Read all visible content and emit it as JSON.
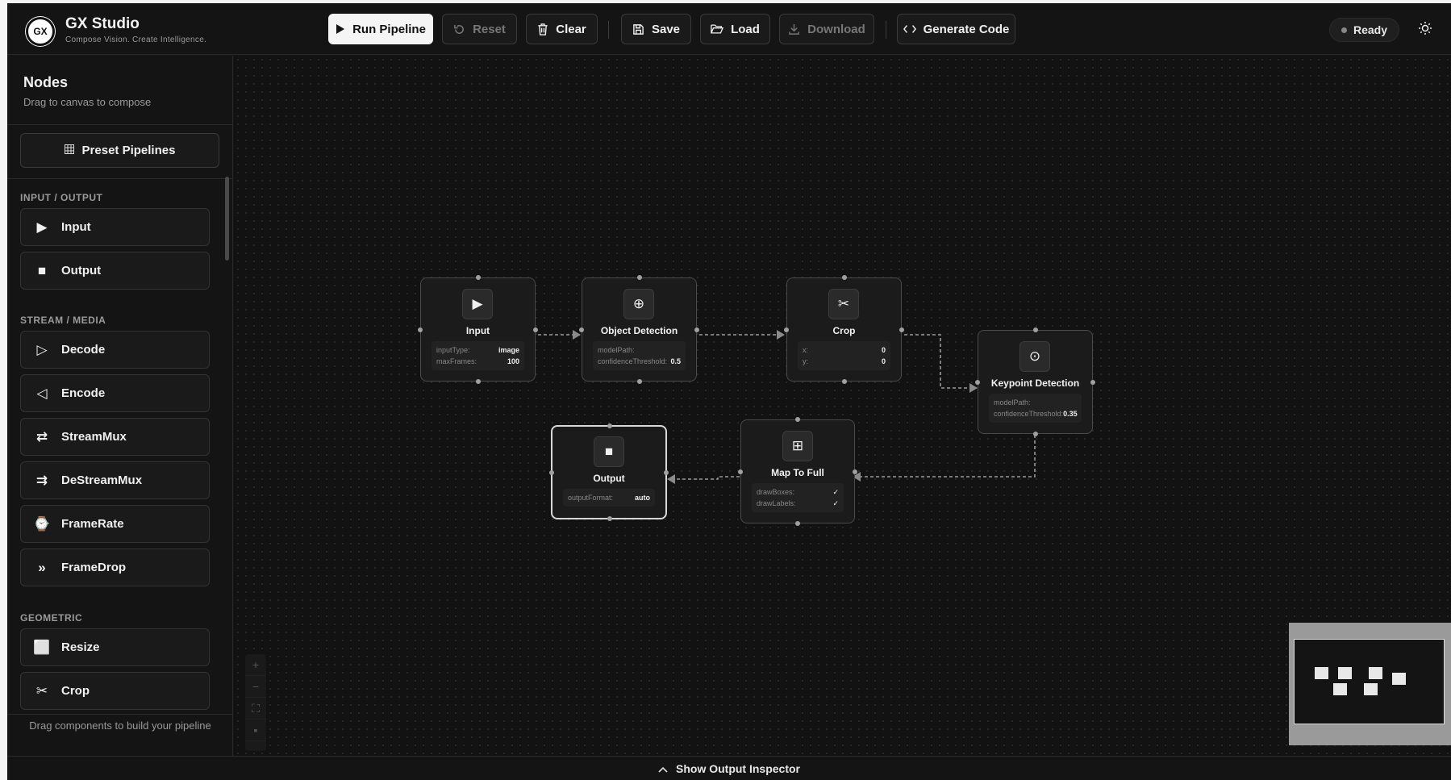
{
  "app": {
    "logo_text": "GX",
    "title": "GX Studio",
    "subtitle": "Compose Vision. Create Intelligence."
  },
  "toolbar": {
    "run": "Run Pipeline",
    "reset": "Reset",
    "clear": "Clear",
    "save": "Save",
    "load": "Load",
    "download": "Download",
    "generate": "Generate Code",
    "status": "Ready"
  },
  "sidebar": {
    "title": "Nodes",
    "subtitle": "Drag to canvas to compose",
    "preset": "Preset Pipelines",
    "footer": "Drag components to build your pipeline",
    "categories": [
      {
        "label": "INPUT / OUTPUT",
        "items": [
          {
            "label": "Input",
            "icon": "play-icon"
          },
          {
            "label": "Output",
            "icon": "stop-icon"
          }
        ]
      },
      {
        "label": "STREAM / MEDIA",
        "items": [
          {
            "label": "Decode",
            "icon": "play-outline-icon"
          },
          {
            "label": "Encode",
            "icon": "reverse-outline-icon"
          },
          {
            "label": "StreamMux",
            "icon": "arrows-swap-icon"
          },
          {
            "label": "DeStreamMux",
            "icon": "arrows-split-icon"
          },
          {
            "label": "FrameRate",
            "icon": "watch-icon"
          },
          {
            "label": "FrameDrop",
            "icon": "fast-forward-icon"
          }
        ]
      },
      {
        "label": "GEOMETRIC",
        "items": [
          {
            "label": "Resize",
            "icon": "square-icon"
          },
          {
            "label": "Crop",
            "icon": "scissors-icon"
          }
        ]
      }
    ]
  },
  "graph": {
    "nodes": [
      {
        "id": "input",
        "title": "Input",
        "icon": "play-icon",
        "params": [
          {
            "k": "inputType:",
            "v": "image"
          },
          {
            "k": "maxFrames:",
            "v": "100"
          }
        ]
      },
      {
        "id": "detect",
        "title": "Object Detection",
        "icon": "crosshair-icon",
        "params": [
          {
            "k": "modelPath:",
            "v": ""
          },
          {
            "k": "confidenceThreshold:",
            "v": "0.5"
          }
        ]
      },
      {
        "id": "crop",
        "title": "Crop",
        "icon": "scissors-icon",
        "params": [
          {
            "k": "x:",
            "v": "0"
          },
          {
            "k": "y:",
            "v": "0"
          }
        ]
      },
      {
        "id": "keypoint",
        "title": "Keypoint Detection",
        "icon": "target-icon",
        "params": [
          {
            "k": "modelPath:",
            "v": ""
          },
          {
            "k": "confidenceThreshold:",
            "v": "0.35"
          }
        ]
      },
      {
        "id": "mapfull",
        "title": "Map To Full",
        "icon": "grid-plus-icon",
        "params": [
          {
            "k": "drawBoxes:",
            "v": "✓"
          },
          {
            "k": "drawLabels:",
            "v": "✓"
          }
        ]
      },
      {
        "id": "output",
        "title": "Output",
        "icon": "stop-icon",
        "params": [
          {
            "k": "outputFormat:",
            "v": "auto"
          }
        ]
      }
    ]
  },
  "inspector": {
    "label": "Show Output Inspector"
  }
}
